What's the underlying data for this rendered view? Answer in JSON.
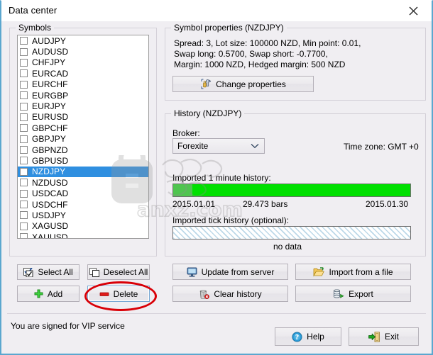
{
  "window": {
    "title": "Data center",
    "close_icon": "close-icon"
  },
  "symbols_group": {
    "legend": "Symbols",
    "items": [
      {
        "label": "AUDJPY",
        "checked": false,
        "selected": false
      },
      {
        "label": "AUDUSD",
        "checked": false,
        "selected": false
      },
      {
        "label": "CHFJPY",
        "checked": false,
        "selected": false
      },
      {
        "label": "EURCAD",
        "checked": false,
        "selected": false
      },
      {
        "label": "EURCHF",
        "checked": false,
        "selected": false
      },
      {
        "label": "EURGBP",
        "checked": false,
        "selected": false
      },
      {
        "label": "EURJPY",
        "checked": false,
        "selected": false
      },
      {
        "label": "EURUSD",
        "checked": false,
        "selected": false
      },
      {
        "label": "GBPCHF",
        "checked": false,
        "selected": false
      },
      {
        "label": "GBPJPY",
        "checked": false,
        "selected": false
      },
      {
        "label": "GBPNZD",
        "checked": false,
        "selected": false
      },
      {
        "label": "GBPUSD",
        "checked": false,
        "selected": false
      },
      {
        "label": "NZDJPY",
        "checked": false,
        "selected": true
      },
      {
        "label": "NZDUSD",
        "checked": false,
        "selected": false
      },
      {
        "label": "USDCAD",
        "checked": false,
        "selected": false
      },
      {
        "label": "USDCHF",
        "checked": false,
        "selected": false
      },
      {
        "label": "USDJPY",
        "checked": false,
        "selected": false
      },
      {
        "label": "XAGUSD",
        "checked": false,
        "selected": false
      },
      {
        "label": "XAUUSD",
        "checked": false,
        "selected": false
      }
    ],
    "select_all": "Select All",
    "deselect_all": "Deselect All",
    "add": "Add",
    "delete": "Delete"
  },
  "properties_group": {
    "legend": "Symbol properties (NZDJPY)",
    "details": "Spread: 3, Lot size: 100000 NZD, Min point: 0.01,\nSwap long: 0.5700, Swap short: -0.7700,\nMargin: 1000 NZD, Hedged margin: 500 NZD",
    "change_button": "Change properties"
  },
  "history_group": {
    "legend": "History (NZDJPY)",
    "broker_label": "Broker:",
    "broker_value": "Forexite",
    "time_zone": "Time zone: GMT +0",
    "minute_history_label": "Imported 1 minute history:",
    "date_start": "2015.01.01",
    "bars": "29.473 bars",
    "date_end": "2015.01.30",
    "progress_fill_percent": 100,
    "tick_history_label": "Imported tick history (optional):",
    "tick_status": "no data",
    "update_from_server": "Update from server",
    "import_from_file": "Import from a file",
    "clear_history": "Clear history",
    "export": "Export"
  },
  "footer": {
    "status": "You are signed for VIP service",
    "help": "Help",
    "exit": "Exit"
  },
  "watermark": {
    "text": "anxz.com"
  },
  "colors": {
    "accent": "#2f8fe0",
    "progress_green": "#00e000",
    "annotation_red": "#d90007",
    "window_border": "#5ba7cf"
  }
}
